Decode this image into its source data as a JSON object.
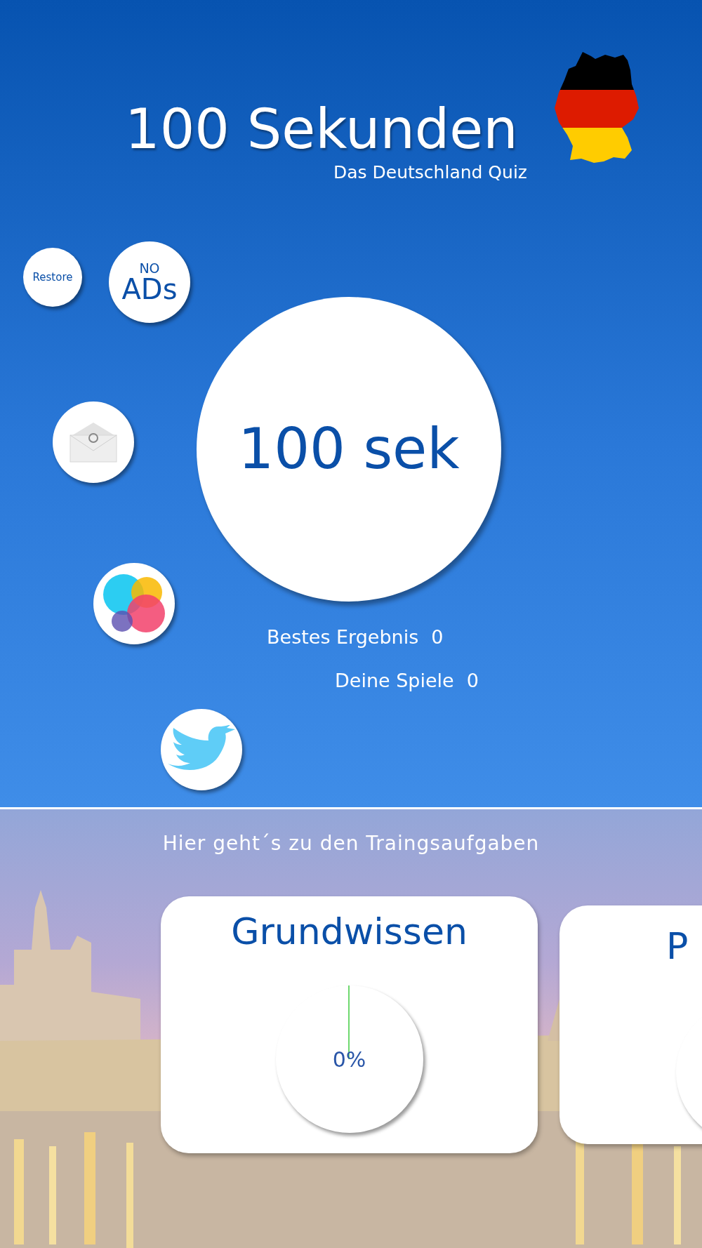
{
  "title": "100 Sekunden",
  "subtitle": "Das Deutschland Quiz",
  "buttons": [
    {
      "kind": "restore",
      "label": "Restore"
    },
    {
      "kind": "no-ads",
      "label_top": "NO",
      "label": "ADs"
    },
    {
      "kind": "mail"
    },
    {
      "kind": "game-center"
    },
    {
      "kind": "twitter"
    }
  ],
  "start": {
    "label": "100 sek"
  },
  "stats": [
    {
      "label": "Bestes Ergebnis",
      "value": "0"
    },
    {
      "label": "Deine Spiele",
      "value": "0"
    }
  ],
  "training": {
    "heading": "Hier geht´s zu den Traingsaufgaben",
    "categories": [
      {
        "title": "Grundwissen",
        "progress": "0%"
      },
      {
        "title": "P"
      }
    ]
  }
}
